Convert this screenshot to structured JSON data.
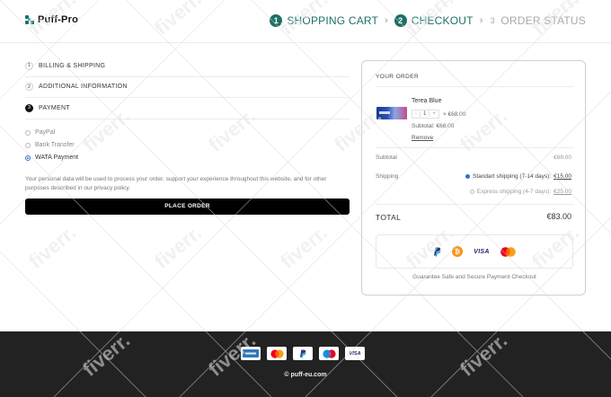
{
  "brand": {
    "name": "Puff-Pro",
    "accent": "#1e6f66"
  },
  "steps": [
    {
      "num": "1",
      "label": "SHOPPING CART",
      "state": "active"
    },
    {
      "num": "2",
      "label": "CHECKOUT",
      "state": "active"
    },
    {
      "num": "3",
      "label": "ORDER STATUS",
      "state": "inactive"
    }
  ],
  "step_separator": "›",
  "checkout": {
    "sections": [
      {
        "num": "1",
        "label": "BILLING & SHIPPING"
      },
      {
        "num": "2",
        "label": "ADDITIONAL INFORMATION"
      },
      {
        "num": "3",
        "label": "PAYMENT"
      }
    ],
    "payment_methods": [
      {
        "label": "PayPal",
        "selected": false
      },
      {
        "label": "Bank Transfer",
        "selected": false
      },
      {
        "label": "WATA Payment",
        "selected": true
      }
    ],
    "privacy_text": "Your personal data will be used to process your order, support your experience throughout this website, and for other purposes described in our privacy policy.",
    "place_order_label": "PLACE ORDER"
  },
  "order": {
    "title": "YOUR ORDER",
    "item": {
      "name": "Terea Blue",
      "qty_minus": "-",
      "qty": "1",
      "qty_plus": "+",
      "price": "× €68.00",
      "subtotal": "Subtotal: €68.00",
      "remove_label": "Remove"
    },
    "subtotal_label": "Subtotal",
    "subtotal_value": "€68.00",
    "shipping_label": "Shipping",
    "shipping_options": [
      {
        "label": "Standart shipping (7-14 days):",
        "amount": "€15.00",
        "selected": true
      },
      {
        "label": "Express shipping (4-7 days):",
        "amount": "€25.00",
        "selected": false
      }
    ],
    "total_label": "TOTAL",
    "total_value": "€83.00",
    "payment_icons": [
      "paypal-icon",
      "bitcoin-icon",
      "visa-icon",
      "mastercard-icon"
    ],
    "visa_text": "VISA",
    "guarantee_text": "Guarantee Safe and Secure Payment Checkout"
  },
  "footer": {
    "card_icons": [
      "amex-icon",
      "mastercard-icon",
      "paypal-icon",
      "maestro-icon",
      "visa-icon"
    ],
    "visa_text": "VISA",
    "copyright": "© puff-eu.com"
  },
  "watermark_text": "fiverr."
}
